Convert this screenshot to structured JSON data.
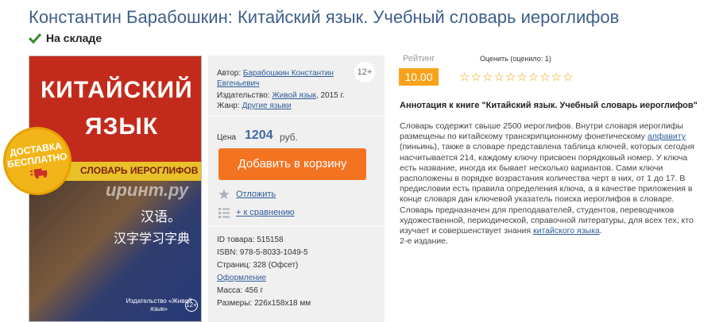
{
  "title": "Константин Барабошкин: Китайский язык. Учебный словарь иероглифов",
  "stock": "На складе",
  "cover": {
    "line1": "КИТАЙСКИЙ",
    "line2": "ЯЗЫК",
    "band": "СЛОВАРЬ ИЕРОГЛИФОВ",
    "cn1": "汉语。",
    "cn2": "汉字学习字典",
    "watermark": "ирuнт.ру",
    "publisher": "Издательство «Живой язык»",
    "age": "12+"
  },
  "badge": {
    "line1": "ДОСТАВКА",
    "line2": "БЕСПЛАТНО"
  },
  "info": {
    "age": "12+",
    "author_label": "Автор:",
    "author_name_1": "Барабошкин Константин",
    "author_name_2": "Евгеньевич",
    "publisher_label": "Издательство:",
    "publisher": "Живой язык",
    "publisher_year": ", 2015 г.",
    "genre_label": "Жанр:",
    "genre": "Другие языки",
    "price_label": "Цена",
    "price": "1204",
    "currency": "руб.",
    "cart_button": "Добавить в корзину",
    "postpone": "Отложить",
    "compare": "+ к сравнению",
    "id": "ID товара: 515158",
    "isbn": "ISBN: 978-5-8033-1049-5",
    "pages": "Страниц: 328 (Офсет)",
    "design": "Оформление",
    "weight": "Масса: 456 г",
    "size": "Размеры: 226x158x18 мм"
  },
  "rating": {
    "label": "Рейтинг",
    "value": "10.00",
    "rate_label": "Оценить (оценило: 1)",
    "stars": 10
  },
  "annotation": {
    "title": "Аннотация к книге \"Китайский язык. Учебный словарь иероглифов\"",
    "p1_a": "Словарь содержит свыше 2500 иероглифов. Внутри словаря иероглифы размещены по китайскому транскрипционному фонетическому ",
    "p1_link": "алфавиту",
    "p1_b": " (пиньинь), также в словаре представлена таблица ключей, которых сегодня насчитывается 214, каждому ключу присвоен порядковый номер. У ключа есть название, иногда их бывает несколько вариантов. Сами ключи расположены в порядке возрастания количества черт в них, от 1 до 17. В предисловии есть правила определения ключа, а в качестве приложения в конце словаря дан ключевой указатель поиска иероглифов в словаре.",
    "p2_a": "Словарь предназначен для преподавателей, студентов, переводчиков художественной, периодической, справочной литературы, для всех тех, кто изучает и совершенствует знания ",
    "p2_link": "китайского языка",
    "p2_b": ".",
    "p3": "2-е издание."
  }
}
